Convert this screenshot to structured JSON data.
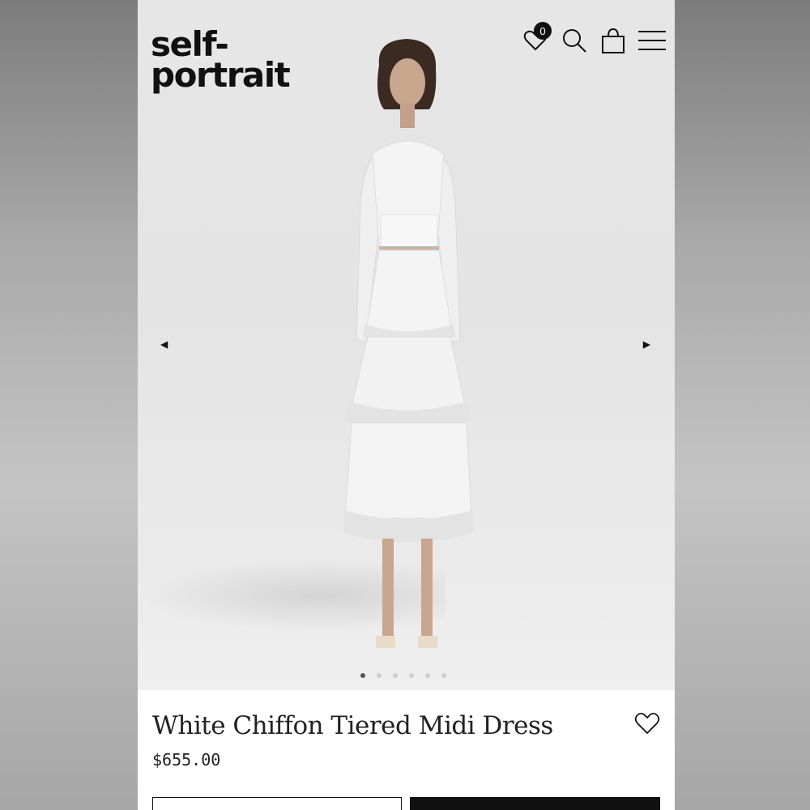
{
  "brand": {
    "logo_line1": "self-",
    "logo_line2": "portrait"
  },
  "header": {
    "wishlist_count": "0",
    "icons": [
      "heart-icon",
      "search-icon",
      "bag-icon",
      "menu-icon"
    ]
  },
  "carousel": {
    "slide_count": 6,
    "active_index": 0
  },
  "product": {
    "title": "White Chiffon Tiered Midi Dress",
    "price": "$655.00"
  },
  "colors": {
    "text": "#111111",
    "button_dark": "#111111",
    "background": "#ffffff"
  }
}
